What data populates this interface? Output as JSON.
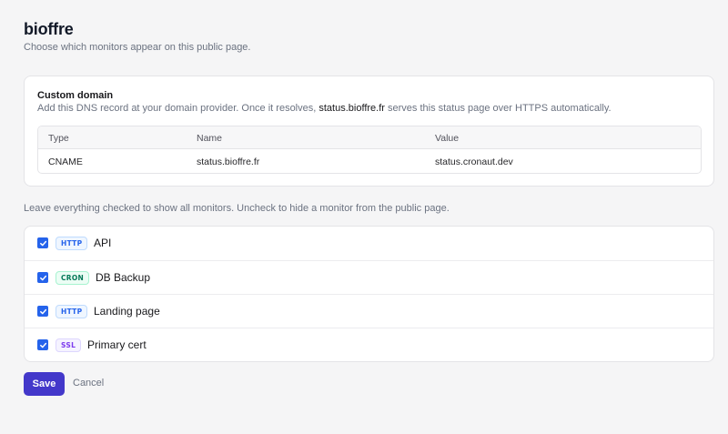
{
  "page": {
    "title": "bioffre",
    "subtitle": "Choose which monitors appear on this public page."
  },
  "custom_domain": {
    "title": "Custom domain",
    "desc_before": "Add this DNS record at your domain provider. Once it resolves,",
    "desc_domain": "status.bioffre.fr",
    "desc_after": "serves this status page over HTTPS automatically.",
    "table": {
      "headers": [
        "Type",
        "Name",
        "Value"
      ],
      "row": [
        "CNAME",
        "status.bioffre.fr",
        "status.cronaut.dev"
      ]
    }
  },
  "monitors": {
    "hint": "Leave everything checked to show all monitors. Uncheck to hide a monitor from the public page.",
    "items": [
      {
        "type": "HTTP",
        "name": "API",
        "checked": true
      },
      {
        "type": "CRON",
        "name": "DB Backup",
        "checked": true
      },
      {
        "type": "HTTP",
        "name": "Landing page",
        "checked": true
      },
      {
        "type": "SSL",
        "name": "Primary cert",
        "checked": true
      }
    ]
  },
  "actions": {
    "save_label": "Save",
    "cancel_label": "Cancel"
  },
  "colors": {
    "accent": "#4338ca",
    "checkbox": "#2563eb",
    "http_badge": "#2563eb",
    "cron_badge": "#047857",
    "ssl_badge": "#7c3aed"
  },
  "icons": {
    "checkbox": "checkmark-icon"
  }
}
